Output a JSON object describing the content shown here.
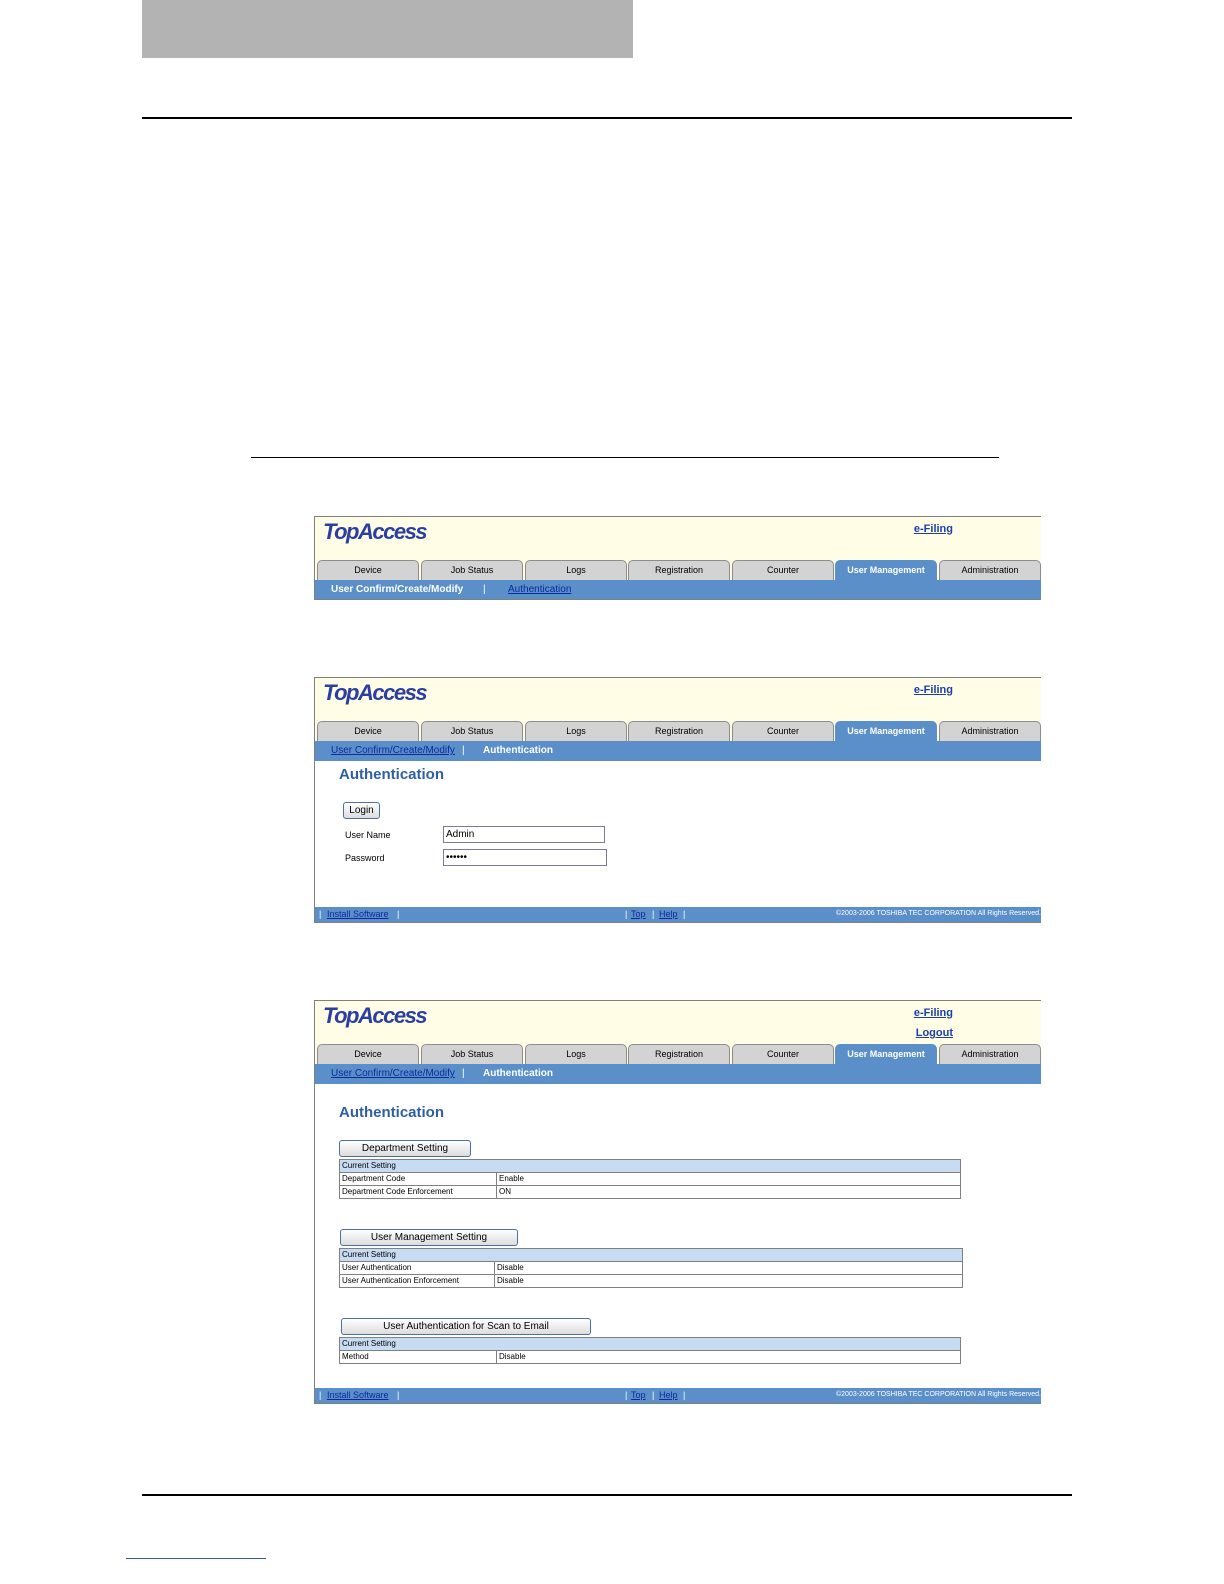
{
  "shot1": {
    "logo": "TopAccess",
    "header_link": "e-Filing",
    "tabs": [
      "Device",
      "Job Status",
      "Logs",
      "Registration",
      "Counter",
      "User Management",
      "Administration"
    ],
    "subnav_active": "User Confirm/Create/Modify",
    "subnav_link": "Authentication",
    "sep": "|"
  },
  "shot2": {
    "logo": "TopAccess",
    "header_link": "e-Filing",
    "tabs": [
      "Device",
      "Job Status",
      "Logs",
      "Registration",
      "Counter",
      "User Management",
      "Administration"
    ],
    "subnav_link": "User Confirm/Create/Modify",
    "subnav_active": "Authentication",
    "sep": "|",
    "title": "Authentication",
    "login_button": "Login",
    "username_label": "User Name",
    "username_value": "Admin",
    "password_label": "Password",
    "password_value": "••••••",
    "footer": {
      "install": "Install Software",
      "top": "Top",
      "help": "Help",
      "bar": "|",
      "copyright": "©2003-2006 TOSHIBA TEC CORPORATION All Rights Reserved."
    }
  },
  "shot3": {
    "logo": "TopAccess",
    "header_link": "e-Filing",
    "logout_link": "Logout",
    "tabs": [
      "Device",
      "Job Status",
      "Logs",
      "Registration",
      "Counter",
      "User Management",
      "Administration"
    ],
    "subnav_link": "User Confirm/Create/Modify",
    "subnav_active": "Authentication",
    "sep": "|",
    "title": "Authentication",
    "dept_button": "Department Setting",
    "dept_table": {
      "head": "Current Setting",
      "rows": [
        [
          "Department Code",
          "Enable"
        ],
        [
          "Department Code Enforcement",
          "ON"
        ]
      ]
    },
    "user_button": "User Management Setting",
    "user_table": {
      "head": "Current Setting",
      "rows": [
        [
          "User Authentication",
          "Disable"
        ],
        [
          "User Authentication Enforcement",
          "Disable"
        ]
      ]
    },
    "scan_button": "User Authentication for Scan to Email",
    "scan_table": {
      "head": "Current Setting",
      "rows": [
        [
          "Method",
          "Disable"
        ]
      ]
    },
    "footer": {
      "install": "Install Software",
      "top": "Top",
      "help": "Help",
      "bar": "|",
      "copyright": "©2003-2006 TOSHIBA TEC CORPORATION All Rights Reserved."
    }
  }
}
